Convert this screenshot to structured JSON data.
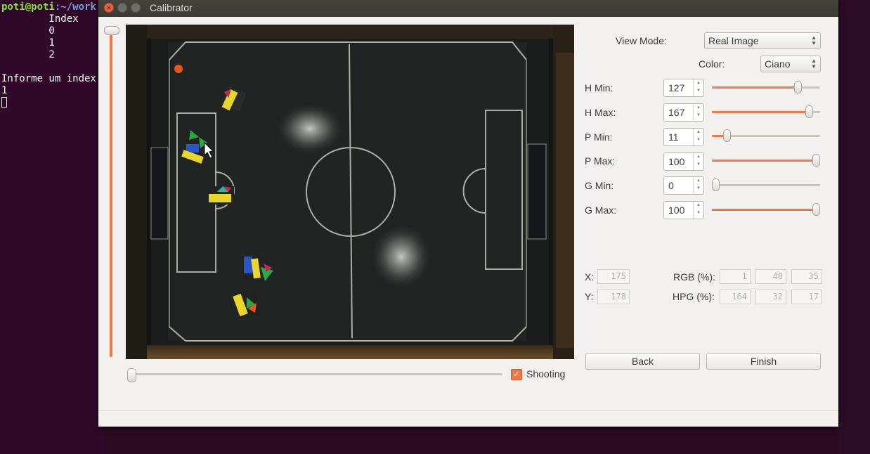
{
  "terminal": {
    "user_host": "poti@poti",
    "path": ":~/work",
    "lines": [
      "        Index",
      "        0",
      "        1",
      "        2",
      "",
      "Informe um index",
      "1"
    ]
  },
  "window": {
    "title": "Calibrator"
  },
  "controls": {
    "view_mode_label": "View Mode:",
    "view_mode_value": "Real Image",
    "color_label": "Color:",
    "color_value": "Ciano",
    "sliders": [
      {
        "label": "H Min:",
        "value": "127",
        "fraction": 0.82
      },
      {
        "label": "H Max:",
        "value": "167",
        "fraction": 0.93
      },
      {
        "label": "P Min:",
        "value": "11",
        "fraction": 0.11
      },
      {
        "label": "P Max:",
        "value": "100",
        "fraction": 1.0
      },
      {
        "label": "G Min:",
        "value": "0",
        "fraction": 0.0
      },
      {
        "label": "G Max:",
        "value": "100",
        "fraction": 1.0
      }
    ],
    "x_label": "X:",
    "x_value": "175",
    "y_label": "Y:",
    "y_value": "178",
    "rgb_label": "RGB (%):",
    "rgb_values": [
      "1",
      "48",
      "35"
    ],
    "hpg_label": "HPG (%):",
    "hpg_values": [
      "164",
      "32",
      "17"
    ],
    "back_label": "Back",
    "finish_label": "Finish"
  },
  "video": {
    "shooting_label": "Shooting",
    "shooting_checked": true,
    "position_fraction": 0.0
  },
  "colors": {
    "accent": "#f07746",
    "close": "#e9623c"
  }
}
